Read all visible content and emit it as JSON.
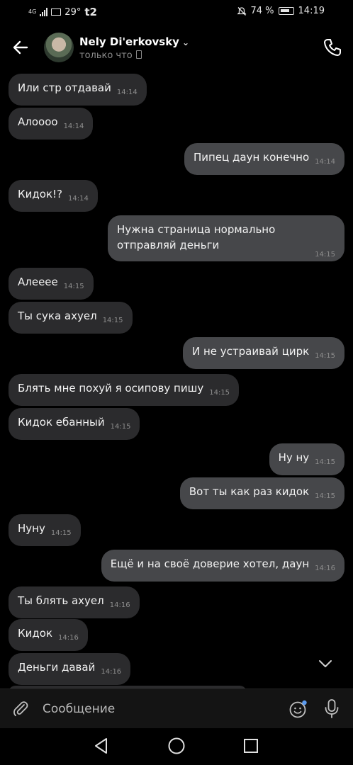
{
  "status_bar": {
    "network": "4G",
    "temperature": "29°",
    "carrier": "t2",
    "battery": "74 %",
    "time": "14:19"
  },
  "header": {
    "contact_name": "Nely Di'erkovsky",
    "status": "только что"
  },
  "messages": [
    {
      "dir": "in",
      "text": "Или стр отдавай",
      "time": "14:14"
    },
    {
      "dir": "in",
      "text": "Алоооо",
      "time": "14:14"
    },
    {
      "dir": "out",
      "text": "Пипец даун конечно",
      "time": "14:14"
    },
    {
      "dir": "in",
      "text": "Кидок!?",
      "time": "14:14"
    },
    {
      "dir": "out",
      "text": "Нужна страница нормально отправляй деньги",
      "time": "14:15"
    },
    {
      "dir": "in",
      "text": "Алееее",
      "time": "14:15"
    },
    {
      "dir": "in",
      "text": "Ты сука ахуел",
      "time": "14:15"
    },
    {
      "dir": "out",
      "text": "И не устраивай цирк",
      "time": "14:15"
    },
    {
      "dir": "in",
      "text": "Блять мне похуй я осипову пишу",
      "time": "14:15"
    },
    {
      "dir": "in",
      "text": "Кидок ебанный",
      "time": "14:15"
    },
    {
      "dir": "out",
      "text": "Ну ну",
      "time": "14:15"
    },
    {
      "dir": "out",
      "text": "Вот ты как раз кидок",
      "time": "14:15"
    },
    {
      "dir": "in",
      "text": "Нуну",
      "time": "14:15"
    },
    {
      "dir": "out",
      "text": "Ещё и на своё доверие хотел, даун",
      "time": "14:16"
    },
    {
      "dir": "in",
      "text": "Ты блять ахуел",
      "time": "14:16"
    },
    {
      "dir": "in",
      "text": "Кидок",
      "time": "14:16"
    },
    {
      "dir": "in",
      "text": "Деньги давай",
      "time": "14:16"
    }
  ],
  "composer": {
    "placeholder": "Сообщение"
  }
}
